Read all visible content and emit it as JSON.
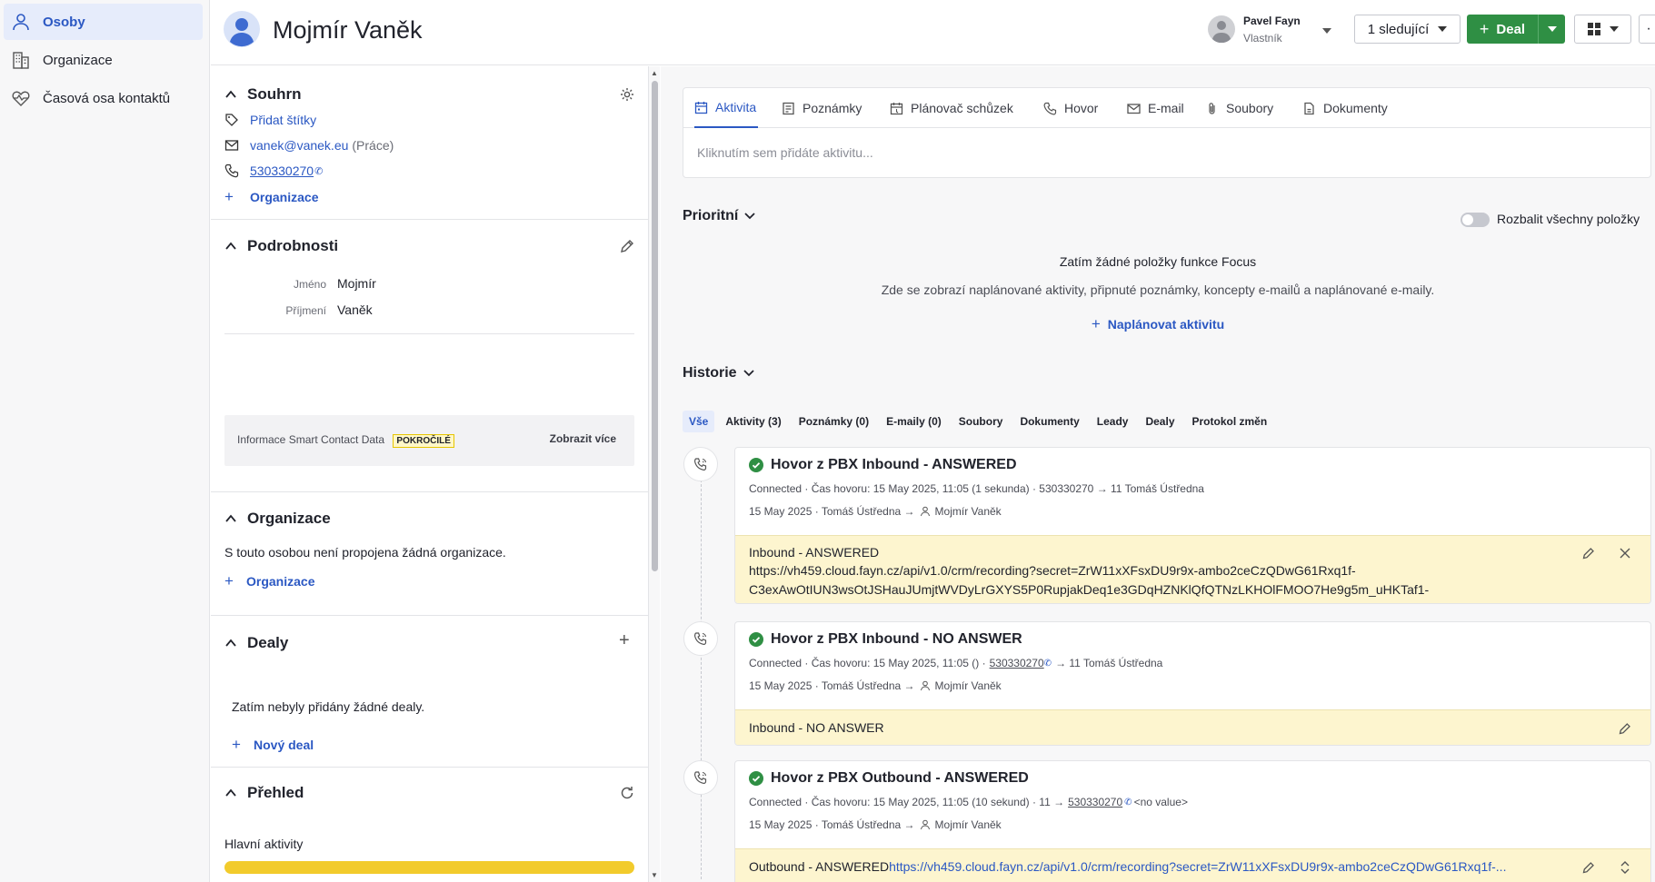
{
  "nav": {
    "items": [
      {
        "label": "Osoby",
        "icon": "person-icon"
      },
      {
        "label": "Organizace",
        "icon": "building-icon"
      },
      {
        "label": "Časová osa kontaktů",
        "icon": "heart-pulse-icon"
      }
    ]
  },
  "header": {
    "person_name": "Mojmír Vaněk",
    "owner_name": "Pavel Fayn",
    "owner_role": "Vlastník",
    "followers_label": "1 sledující",
    "deal_label": "Deal"
  },
  "summary": {
    "title": "Souhrn",
    "add_tags": "Přidat štítky",
    "email": "vanek@vanek.eu",
    "email_type": "(Práce)",
    "phone": "530330270",
    "add_org": "Organizace"
  },
  "details": {
    "title": "Podrobnosti",
    "first_name_label": "Jméno",
    "first_name": "Mojmír",
    "last_name_label": "Příjmení",
    "last_name": "Vaněk",
    "smart_label": "Informace Smart Contact Data",
    "smart_badge": "POKROČILÉ",
    "smart_more": "Zobrazit více"
  },
  "organization": {
    "title": "Organizace",
    "empty": "S touto osobou není propojena žádná organizace.",
    "add": "Organizace"
  },
  "deals": {
    "title": "Dealy",
    "empty": "Zatím nebyly přidány žádné dealy.",
    "add": "Nový deal"
  },
  "overview": {
    "title": "Přehled",
    "main_activities": "Hlavní aktivity",
    "bar_color": "#f2cb2c"
  },
  "composer": {
    "tabs": [
      {
        "label": "Aktivita",
        "icon": "calendar-icon"
      },
      {
        "label": "Poznámky",
        "icon": "note-icon"
      },
      {
        "label": "Plánovač schůzek",
        "icon": "scheduler-icon"
      },
      {
        "label": "Hovor",
        "icon": "phone-icon"
      },
      {
        "label": "E-mail",
        "icon": "mail-icon"
      },
      {
        "label": "Soubory",
        "icon": "paperclip-icon"
      },
      {
        "label": "Dokumenty",
        "icon": "document-icon"
      }
    ],
    "placeholder": "Kliknutím sem přidáte aktivitu..."
  },
  "focus": {
    "title": "Prioritní",
    "toggle_label": "Rozbalit všechny položky",
    "empty_title": "Zatím žádné položky funkce Focus",
    "empty_desc": "Zde se zobrazí naplánované aktivity, připnuté poznámky, koncepty e-mailů a naplánované e-maily.",
    "schedule": "Naplánovat aktivitu"
  },
  "history": {
    "title": "Historie",
    "filters": [
      "Vše",
      "Aktivity (3)",
      "Poznámky (0)",
      "E-maily (0)",
      "Soubory",
      "Dokumenty",
      "Leady",
      "Dealy",
      "Protokol změn"
    ],
    "items": [
      {
        "title": "Hovor z PBX Inbound - ANSWERED",
        "meta1": "Connected · Čas hovoru: 15 May 2025, 11:05 (1 sekunda) · 530330270 → 11 Tomáš Ústředna",
        "meta2_date": "15 May 2025 · Tomáš Ústředna →",
        "meta2_person": "Mojmír Vaněk",
        "note_title": "Inbound - ANSWERED",
        "note_link1": "https://vh459.cloud.fayn.cz/api/v1.0/crm/recording?secret=ZrW11xXFsxDU9r9x-ambo2ceCzQDwG61Rxq1f-",
        "note_link2": "C3exAwOtIUN3wsOtJSHauJUmjtWVDyLrGXYS5P0RupjakDeq1e3GDqHZNKlQfQTNzLKHOlFMOO7He9g5m_uHKTaf1-"
      },
      {
        "title": "Hovor z PBX Inbound - NO ANSWER",
        "meta1_pre": "Connected · Čas hovoru: 15 May 2025, 11:05 () ·",
        "meta1_phone": "530330270",
        "meta1_post": "→ 11 Tomáš Ústředna",
        "meta2_date": "15 May 2025 · Tomáš Ústředna →",
        "meta2_person": "Mojmír Vaněk",
        "note_title": "Inbound - NO ANSWER"
      },
      {
        "title": "Hovor z PBX Outbound - ANSWERED",
        "meta1_pre": "Connected · Čas hovoru: 15 May 2025, 11:05 (10 sekund) · 11 →",
        "meta1_phone": "530330270",
        "meta1_post": "<no value>",
        "meta2_date": "15 May 2025 · Tomáš Ústředna →",
        "meta2_person": "Mojmír Vaněk",
        "note_title": "Outbound - ANSWERED",
        "note_link": "https://vh459.cloud.fayn.cz/api/v1.0/crm/recording?secret=ZrW11xXFsxDU9r9x-ambo2ceCzQDwG61Rxq1f-..."
      }
    ]
  },
  "colors": {
    "accent": "#2b58c3",
    "green": "#2f8f44",
    "note_bg": "#fdf5cf",
    "success": "#2f8f44"
  }
}
